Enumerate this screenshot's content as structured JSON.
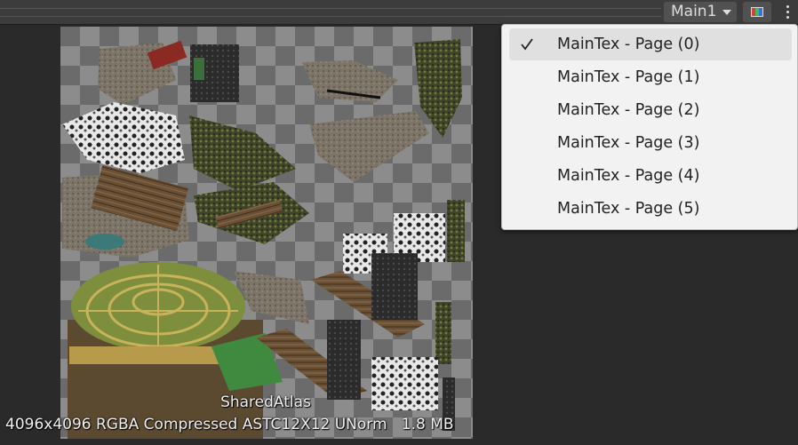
{
  "toolbar": {
    "page_dropdown_label": "Main1",
    "color_button_icon": "rgb-channels-icon",
    "menu_icon": "kebab-menu-icon"
  },
  "atlas_preview": {
    "name": "SharedAtlas",
    "meta": "4096x4096 RGBA Compressed ASTC12X12 UNorm   1.8 MB"
  },
  "dropdown_menu": {
    "selected_index": 0,
    "items": [
      {
        "label": "MainTex - Page (0)",
        "checked": true
      },
      {
        "label": "MainTex - Page (1)",
        "checked": false
      },
      {
        "label": "MainTex - Page (2)",
        "checked": false
      },
      {
        "label": "MainTex - Page (3)",
        "checked": false
      },
      {
        "label": "MainTex - Page (4)",
        "checked": false
      },
      {
        "label": "MainTex - Page (5)",
        "checked": false
      }
    ]
  },
  "colors": {
    "panel_background": "#2a2a2a",
    "toolbar_background": "#3c3c3c",
    "menu_background": "#f2f2f2",
    "menu_selected": "#e0e0e0"
  }
}
